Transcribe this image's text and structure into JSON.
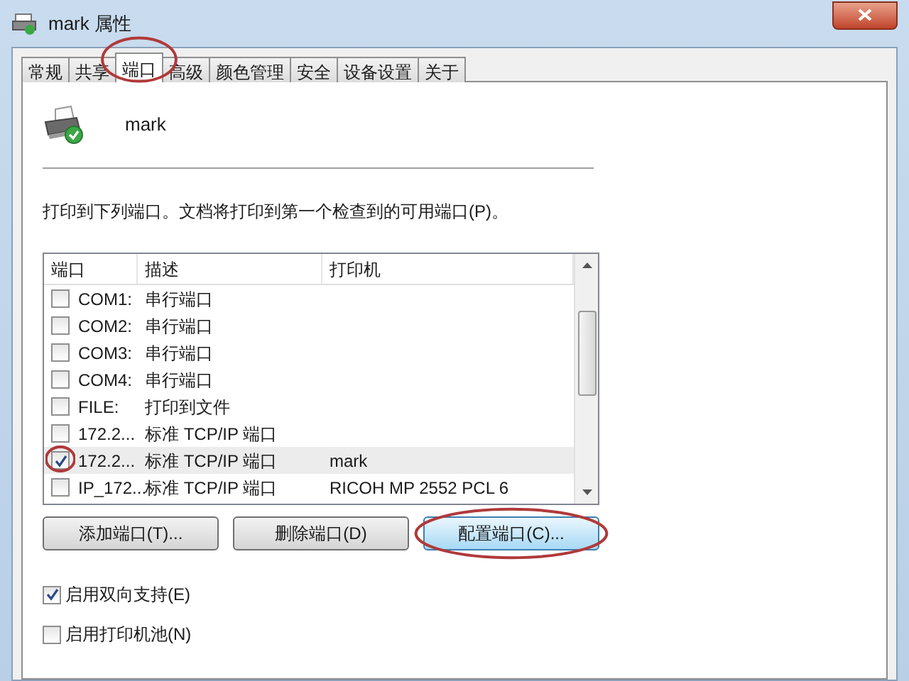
{
  "window": {
    "title": "mark 属性"
  },
  "tabs": [
    {
      "label": "常规",
      "selected": false
    },
    {
      "label": "共享",
      "selected": false
    },
    {
      "label": "端口",
      "selected": true,
      "annotated": true
    },
    {
      "label": "高级",
      "selected": false
    },
    {
      "label": "颜色管理",
      "selected": false
    },
    {
      "label": "安全",
      "selected": false
    },
    {
      "label": "设备设置",
      "selected": false
    },
    {
      "label": "关于",
      "selected": false
    }
  ],
  "printer_name": "mark",
  "instruction": "打印到下列端口。文档将打印到第一个检查到的可用端口(P)。",
  "port_table": {
    "columns": [
      "端口",
      "描述",
      "打印机"
    ],
    "rows": [
      {
        "port": "COM1:",
        "description": "串行端口",
        "checked": false,
        "selected": false
      },
      {
        "port": "COM2:",
        "description": "串行端口",
        "checked": false,
        "selected": false
      },
      {
        "port": "COM3:",
        "description": "串行端口",
        "checked": false,
        "selected": false
      },
      {
        "port": "COM4:",
        "description": "串行端口",
        "checked": false,
        "selected": false
      },
      {
        "port": "FILE:",
        "description": "打印到文件",
        "checked": false,
        "selected": false
      },
      {
        "port": "172.2...",
        "description": "标准 TCP/IP 端口",
        "checked": false,
        "selected": false
      },
      {
        "port": "172.2...",
        "description": "标准 TCP/IP 端口",
        "printer": "mark",
        "checked": true,
        "selected": true,
        "annotated": true
      },
      {
        "port": "IP_172...",
        "description": "标准 TCP/IP 端口",
        "printer": "RICOH MP 2552 PCL 6",
        "checked": false,
        "selected": false
      }
    ]
  },
  "buttons": [
    {
      "label": "添加端口(T)...",
      "focused": false,
      "annotated": false
    },
    {
      "label": "删除端口(D)",
      "focused": false,
      "annotated": false
    },
    {
      "label": "配置端口(C)...",
      "focused": true,
      "annotated": true
    }
  ],
  "options": [
    {
      "label": "启用双向支持(E)",
      "checked": true
    },
    {
      "label": "启用打印机池(N)",
      "checked": false
    }
  ]
}
